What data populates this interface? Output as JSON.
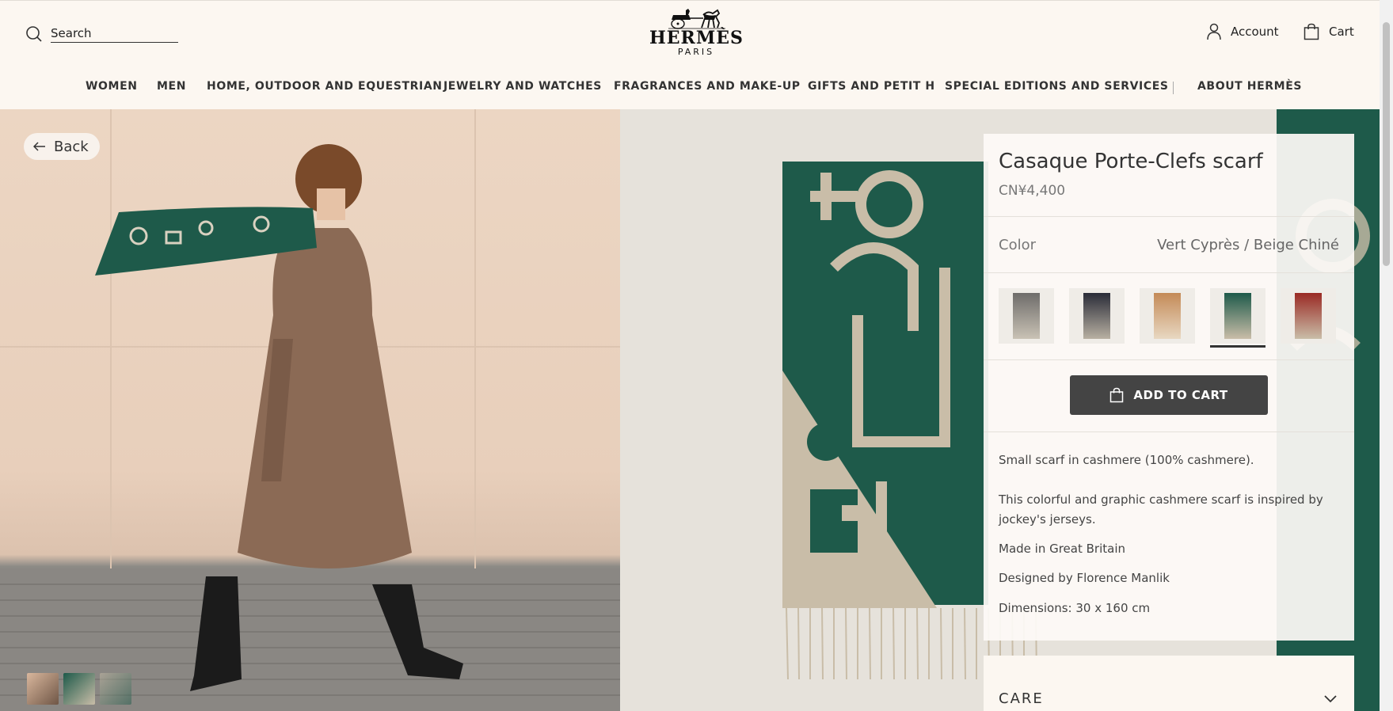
{
  "header": {
    "search_placeholder": "Search",
    "logo_word": "HERMÈS",
    "logo_sub": "PARIS",
    "account_label": "Account",
    "cart_label": "Cart"
  },
  "nav": {
    "items": [
      "WOMEN",
      "MEN",
      "HOME, OUTDOOR AND EQUESTRIAN",
      "JEWELRY AND WATCHES",
      "FRAGRANCES AND MAKE-UP",
      "GIFTS AND PETIT H",
      "SPECIAL EDITIONS AND SERVICES",
      "ABOUT HERMÈS"
    ]
  },
  "gallery": {
    "back_label": "Back"
  },
  "product": {
    "title": "Casaque Porte-Clefs scarf",
    "price": "CN¥4,400",
    "color_label": "Color",
    "color_value": "Vert Cyprès / Beige Chiné",
    "swatches": [
      {
        "name": "grey",
        "color": "#6e6c6a"
      },
      {
        "name": "navy",
        "color": "#2a2c38"
      },
      {
        "name": "camel",
        "color": "#c48a57"
      },
      {
        "name": "green",
        "color": "#1e5a4a"
      },
      {
        "name": "red",
        "color": "#9a2a24"
      }
    ],
    "selected_swatch": 3,
    "add_to_cart_label": "ADD TO CART",
    "description": "Small scarf in cashmere (100% cashmere).",
    "story": "This colorful and graphic cashmere scarf is inspired by jockey's jerseys.",
    "made_in": "Made in Great Britain",
    "designer": "Designed by Florence Manlik",
    "dimensions": "Dimensions: 30 x 160 cm",
    "care_label": "CARE"
  },
  "colors": {
    "background": "#fcf7f1",
    "scarf_green": "#1e5a4a",
    "scarf_beige": "#c9bda8",
    "button": "#444444"
  }
}
